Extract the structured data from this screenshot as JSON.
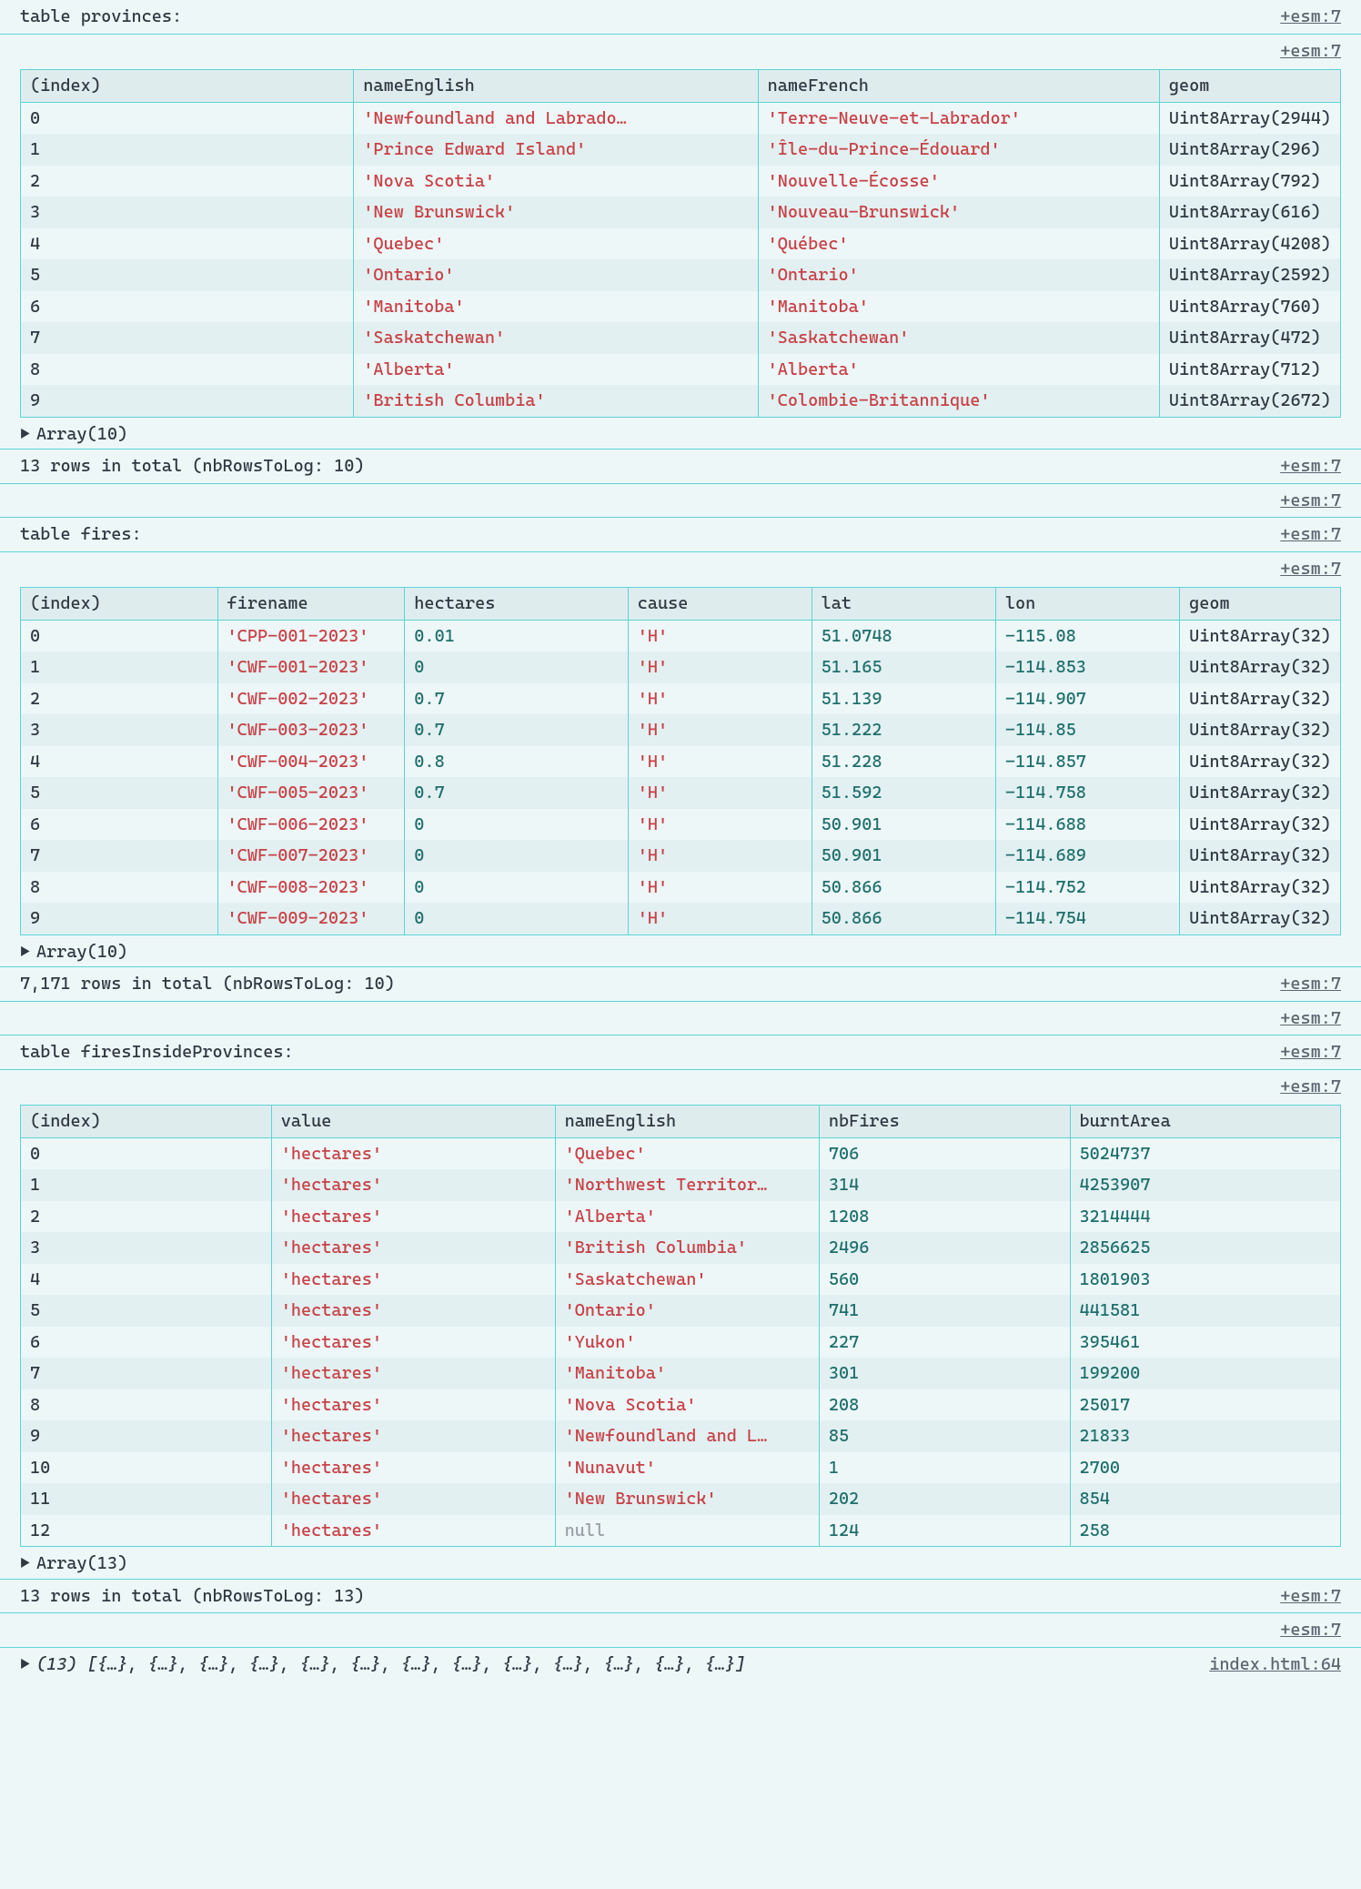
{
  "sourceLink": "+esm:7",
  "sourceLink2": "index.html:64",
  "tables": [
    {
      "title": "table provinces:",
      "cols": [
        "(index)",
        "nameEnglish",
        "nameFrench",
        "geom"
      ],
      "colTypes": [
        "idx",
        "str",
        "str",
        "obj"
      ],
      "rows": [
        [
          "0",
          "'Newfoundland and Labrado…",
          "'Terre-Neuve-et-Labrador'",
          "Uint8Array(2944)"
        ],
        [
          "1",
          "'Prince Edward Island'",
          "'Île-du-Prince-Édouard'",
          "Uint8Array(296)"
        ],
        [
          "2",
          "'Nova Scotia'",
          "'Nouvelle-Écosse'",
          "Uint8Array(792)"
        ],
        [
          "3",
          "'New Brunswick'",
          "'Nouveau-Brunswick'",
          "Uint8Array(616)"
        ],
        [
          "4",
          "'Quebec'",
          "'Québec'",
          "Uint8Array(4208)"
        ],
        [
          "5",
          "'Ontario'",
          "'Ontario'",
          "Uint8Array(2592)"
        ],
        [
          "6",
          "'Manitoba'",
          "'Manitoba'",
          "Uint8Array(760)"
        ],
        [
          "7",
          "'Saskatchewan'",
          "'Saskatchewan'",
          "Uint8Array(472)"
        ],
        [
          "8",
          "'Alberta'",
          "'Alberta'",
          "Uint8Array(712)"
        ],
        [
          "9",
          "'British Columbia'",
          "'Colombie-Britannique'",
          "Uint8Array(2672)"
        ]
      ],
      "arraySummary": "Array(10)",
      "footer": "13 rows in total (nbRowsToLog: 10)"
    },
    {
      "title": "table fires:",
      "cols": [
        "(index)",
        "firename",
        "hectares",
        "cause",
        "lat",
        "lon",
        "geom"
      ],
      "colTypes": [
        "idx",
        "str",
        "num",
        "str",
        "num",
        "num",
        "obj"
      ],
      "rows": [
        [
          "0",
          "'CPP-001-2023'",
          "0.01",
          "'H'",
          "51.0748",
          "-115.08",
          "Uint8Array(32)"
        ],
        [
          "1",
          "'CWF-001-2023'",
          "0",
          "'H'",
          "51.165",
          "-114.853",
          "Uint8Array(32)"
        ],
        [
          "2",
          "'CWF-002-2023'",
          "0.7",
          "'H'",
          "51.139",
          "-114.907",
          "Uint8Array(32)"
        ],
        [
          "3",
          "'CWF-003-2023'",
          "0.7",
          "'H'",
          "51.222",
          "-114.85",
          "Uint8Array(32)"
        ],
        [
          "4",
          "'CWF-004-2023'",
          "0.8",
          "'H'",
          "51.228",
          "-114.857",
          "Uint8Array(32)"
        ],
        [
          "5",
          "'CWF-005-2023'",
          "0.7",
          "'H'",
          "51.592",
          "-114.758",
          "Uint8Array(32)"
        ],
        [
          "6",
          "'CWF-006-2023'",
          "0",
          "'H'",
          "50.901",
          "-114.688",
          "Uint8Array(32)"
        ],
        [
          "7",
          "'CWF-007-2023'",
          "0",
          "'H'",
          "50.901",
          "-114.689",
          "Uint8Array(32)"
        ],
        [
          "8",
          "'CWF-008-2023'",
          "0",
          "'H'",
          "50.866",
          "-114.752",
          "Uint8Array(32)"
        ],
        [
          "9",
          "'CWF-009-2023'",
          "0",
          "'H'",
          "50.866",
          "-114.754",
          "Uint8Array(32)"
        ]
      ],
      "arraySummary": "Array(10)",
      "footer": "7,171 rows in total (nbRowsToLog: 10)"
    },
    {
      "title": "table firesInsideProvinces:",
      "cols": [
        "(index)",
        "value",
        "nameEnglish",
        "nbFires",
        "burntArea"
      ],
      "colTypes": [
        "idx",
        "str",
        "str",
        "num",
        "num"
      ],
      "rows": [
        [
          "0",
          "'hectares'",
          "'Quebec'",
          "706",
          "5024737"
        ],
        [
          "1",
          "'hectares'",
          "'Northwest Territor…",
          "314",
          "4253907"
        ],
        [
          "2",
          "'hectares'",
          "'Alberta'",
          "1208",
          "3214444"
        ],
        [
          "3",
          "'hectares'",
          "'British Columbia'",
          "2496",
          "2856625"
        ],
        [
          "4",
          "'hectares'",
          "'Saskatchewan'",
          "560",
          "1801903"
        ],
        [
          "5",
          "'hectares'",
          "'Ontario'",
          "741",
          "441581"
        ],
        [
          "6",
          "'hectares'",
          "'Yukon'",
          "227",
          "395461"
        ],
        [
          "7",
          "'hectares'",
          "'Manitoba'",
          "301",
          "199200"
        ],
        [
          "8",
          "'hectares'",
          "'Nova Scotia'",
          "208",
          "25017"
        ],
        [
          "9",
          "'hectares'",
          "'Newfoundland and L…",
          "85",
          "21833"
        ],
        [
          "10",
          "'hectares'",
          "'Nunavut'",
          "1",
          "2700"
        ],
        [
          "11",
          "'hectares'",
          "'New Brunswick'",
          "202",
          "854"
        ],
        [
          "12",
          "'hectares'",
          "null",
          "124",
          "258"
        ]
      ],
      "arraySummary": "Array(13)",
      "footer": "13 rows in total (nbRowsToLog: 13)"
    }
  ],
  "arrayDump": "(13) [{…}, {…}, {…}, {…}, {…}, {…}, {…}, {…}, {…}, {…}, {…}, {…}, {…}]"
}
